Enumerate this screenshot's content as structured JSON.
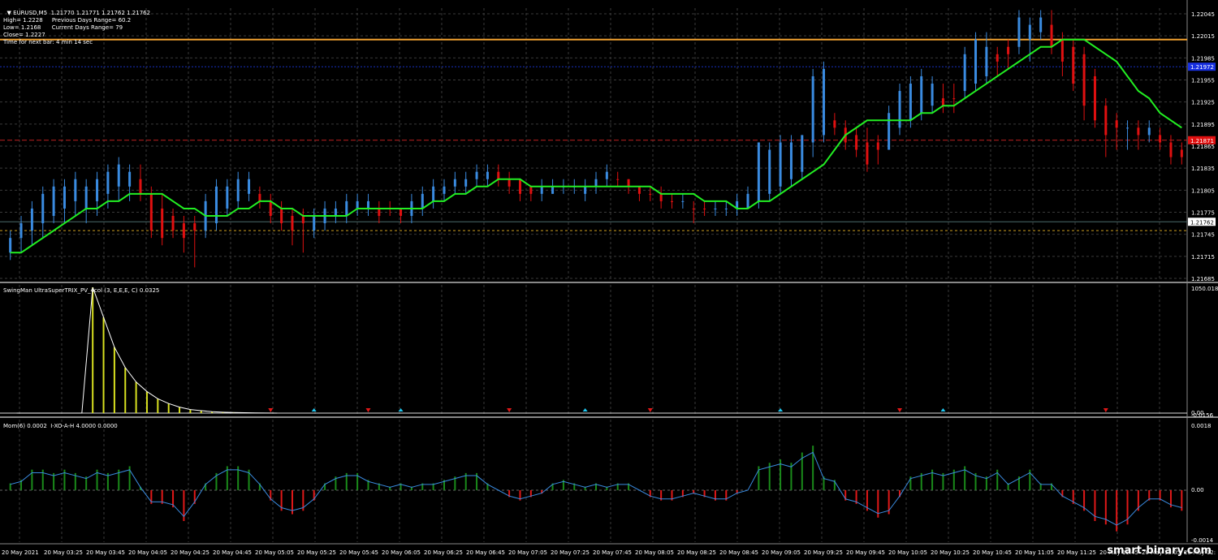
{
  "colors": {
    "background": "#000000",
    "grid": "#3a3a3a",
    "bull": "#3a8be0",
    "bear": "#e01010",
    "ma": "#22ee22",
    "orange_line": "#f0a030",
    "blue_line": "#1830c0",
    "red_dash": "#c02020",
    "bid_line": "#4a6a6a",
    "yellow_dash": "#d0a020",
    "trix": "#ffffff",
    "trix_bar": "#d8e020",
    "arrow_up": "#20c8f0",
    "arrow_down": "#e01818",
    "mom_pos": "#1a8a1a",
    "mom_neg": "#e01818",
    "mom_line": "#3a8be0"
  },
  "main": {
    "symbol": "EURUSD,M5",
    "ohlc": "1.21770 1.21771 1.21762 1.21762",
    "high": "High= 1.2228",
    "prev_range": "Previous Days Range= 60.2",
    "low": "Low= 1.2168",
    "curr_range": "Current Days Range= 79",
    "close": "Close= 1.2227",
    "timer": "Time for next bar: 4 min 14 sec",
    "price_axis": [
      "1.22045",
      "1.22015",
      "1.21985",
      "1.21955",
      "1.21925",
      "1.21895",
      "1.21865",
      "1.21835",
      "1.21805",
      "1.21775",
      "1.21745",
      "1.21715",
      "1.21685"
    ],
    "levels": {
      "orange": 1.2201,
      "blue": 1.21973,
      "red": 1.21873,
      "bid": 1.21762,
      "yellow": 1.2175
    },
    "level_labels": {
      "blue": "1.21972",
      "red": "1.21871",
      "bid": "1.21762"
    }
  },
  "trix": {
    "label": "SwingMan UltraSuperTRIX_PV_4col (3, E,E,E, C) 0.0325",
    "axis_top": "1050.0187",
    "axis_mid": "0.00",
    "axis_bottom": "-0.0156"
  },
  "mom": {
    "label": "Mom(6) 0.0002  I-XO-A-H 4.0000 0.0000",
    "axis_top": "0.0018",
    "axis_mid": "0.00",
    "axis_bottom": "-0.0014"
  },
  "time_axis": [
    "20 May 2021",
    "20 May 03:25",
    "20 May 03:45",
    "20 May 04:05",
    "20 May 04:25",
    "20 May 04:45",
    "20 May 05:05",
    "20 May 05:25",
    "20 May 05:45",
    "20 May 06:05",
    "20 May 06:25",
    "20 May 06:45",
    "20 May 07:05",
    "20 May 07:25",
    "20 May 07:45",
    "20 May 08:05",
    "20 May 08:25",
    "20 May 08:45",
    "20 May 09:05",
    "20 May 09:25",
    "20 May 09:45",
    "20 May 10:05",
    "20 May 10:25",
    "20 May 10:45",
    "20 May 11:05",
    "20 May 11:25",
    "20 May 11:45",
    "20 May 12:05",
    "20 May 12:"
  ],
  "watermark": "smart-binary.com",
  "chart_data": {
    "type": "bar",
    "title": "EURUSD,M5",
    "ylim": [
      1.2168,
      1.2207
    ],
    "candles": [
      [
        0,
        1.2172,
        1.2175,
        1.2171,
        1.2174,
        1
      ],
      [
        1,
        1.2174,
        1.2177,
        1.2172,
        1.2176,
        1
      ],
      [
        2,
        1.2175,
        1.2179,
        1.2173,
        1.2178,
        1
      ],
      [
        3,
        1.2176,
        1.2181,
        1.2174,
        1.218,
        1
      ],
      [
        4,
        1.2177,
        1.2182,
        1.2176,
        1.2181,
        1
      ],
      [
        5,
        1.2178,
        1.2182,
        1.2176,
        1.2181,
        1
      ],
      [
        6,
        1.2179,
        1.2183,
        1.2177,
        1.2182,
        1
      ],
      [
        7,
        1.2178,
        1.2182,
        1.2176,
        1.2181,
        1
      ],
      [
        8,
        1.2179,
        1.2183,
        1.2177,
        1.2182,
        1
      ],
      [
        9,
        1.218,
        1.2184,
        1.2178,
        1.2183,
        1
      ],
      [
        10,
        1.2181,
        1.2185,
        1.2179,
        1.2184,
        1
      ],
      [
        11,
        1.2181,
        1.2184,
        1.2179,
        1.2183,
        1
      ],
      [
        12,
        1.2182,
        1.2184,
        1.2179,
        1.218,
        0
      ],
      [
        13,
        1.218,
        1.2181,
        1.2174,
        1.2175,
        0
      ],
      [
        14,
        1.2178,
        1.218,
        1.2173,
        1.2174,
        0
      ],
      [
        15,
        1.2177,
        1.2178,
        1.2174,
        1.2175,
        0
      ],
      [
        16,
        1.2176,
        1.2177,
        1.2172,
        1.2174,
        0
      ],
      [
        17,
        1.2176,
        1.2177,
        1.217,
        1.2175,
        0
      ],
      [
        18,
        1.2175,
        1.218,
        1.2174,
        1.2179,
        1
      ],
      [
        19,
        1.2176,
        1.2182,
        1.2175,
        1.2181,
        1
      ],
      [
        20,
        1.2178,
        1.2182,
        1.2177,
        1.2181,
        1
      ],
      [
        21,
        1.2179,
        1.2183,
        1.2178,
        1.2182,
        1
      ],
      [
        22,
        1.218,
        1.2183,
        1.2179,
        1.2182,
        1
      ],
      [
        23,
        1.218,
        1.2181,
        1.2178,
        1.2179,
        0
      ],
      [
        24,
        1.2179,
        1.218,
        1.2176,
        1.2177,
        0
      ],
      [
        25,
        1.2178,
        1.2179,
        1.2175,
        1.2176,
        0
      ],
      [
        26,
        1.2177,
        1.2178,
        1.2173,
        1.2175,
        0
      ],
      [
        27,
        1.2176,
        1.2178,
        1.2172,
        1.2177,
        0
      ],
      [
        28,
        1.2175,
        1.2178,
        1.2174,
        1.2177,
        1
      ],
      [
        29,
        1.2176,
        1.2179,
        1.2175,
        1.2178,
        1
      ],
      [
        30,
        1.2177,
        1.2179,
        1.2176,
        1.2178,
        1
      ],
      [
        31,
        1.2177,
        1.218,
        1.2176,
        1.2179,
        1
      ],
      [
        32,
        1.2178,
        1.218,
        1.2177,
        1.2179,
        1
      ],
      [
        33,
        1.2178,
        1.218,
        1.2177,
        1.2179,
        1
      ],
      [
        34,
        1.2178,
        1.2179,
        1.2176,
        1.2177,
        0
      ],
      [
        35,
        1.2178,
        1.2179,
        1.2177,
        1.2178,
        0
      ],
      [
        36,
        1.2178,
        1.2178,
        1.2176,
        1.2177,
        0
      ],
      [
        37,
        1.2177,
        1.218,
        1.2176,
        1.2179,
        1
      ],
      [
        38,
        1.2178,
        1.2181,
        1.2177,
        1.218,
        1
      ],
      [
        39,
        1.2179,
        1.2182,
        1.2178,
        1.2181,
        1
      ],
      [
        40,
        1.218,
        1.2182,
        1.2179,
        1.2181,
        1
      ],
      [
        41,
        1.2181,
        1.2183,
        1.218,
        1.2182,
        1
      ],
      [
        42,
        1.2181,
        1.2183,
        1.218,
        1.2182,
        1
      ],
      [
        43,
        1.2182,
        1.2184,
        1.2181,
        1.2183,
        1
      ],
      [
        44,
        1.2182,
        1.2184,
        1.2181,
        1.2183,
        1
      ],
      [
        45,
        1.2183,
        1.2184,
        1.2181,
        1.2182,
        0
      ],
      [
        46,
        1.2182,
        1.2183,
        1.218,
        1.2181,
        0
      ],
      [
        47,
        1.2182,
        1.2182,
        1.2179,
        1.218,
        0
      ],
      [
        48,
        1.2181,
        1.2181,
        1.2179,
        1.218,
        0
      ],
      [
        49,
        1.218,
        1.2182,
        1.2179,
        1.2181,
        1
      ],
      [
        50,
        1.218,
        1.2182,
        1.218,
        1.2181,
        1
      ],
      [
        51,
        1.2181,
        1.2182,
        1.218,
        1.2181,
        1
      ],
      [
        52,
        1.2181,
        1.2182,
        1.218,
        1.2181,
        1
      ],
      [
        53,
        1.218,
        1.2182,
        1.2179,
        1.2181,
        1
      ],
      [
        54,
        1.2181,
        1.2183,
        1.218,
        1.2182,
        1
      ],
      [
        55,
        1.2182,
        1.2184,
        1.2181,
        1.2183,
        1
      ],
      [
        56,
        1.2182,
        1.2183,
        1.2181,
        1.2182,
        0
      ],
      [
        57,
        1.2182,
        1.2182,
        1.218,
        1.2181,
        0
      ],
      [
        58,
        1.2181,
        1.2181,
        1.2179,
        1.218,
        0
      ],
      [
        59,
        1.218,
        1.2181,
        1.2179,
        1.218,
        0
      ],
      [
        60,
        1.218,
        1.2181,
        1.2178,
        1.2179,
        0
      ],
      [
        61,
        1.2179,
        1.218,
        1.2178,
        1.2179,
        0
      ],
      [
        62,
        1.2179,
        1.218,
        1.2178,
        1.2179,
        1
      ],
      [
        63,
        1.2178,
        1.2179,
        1.2176,
        1.2178,
        0
      ],
      [
        64,
        1.2178,
        1.2179,
        1.2177,
        1.2178,
        0
      ],
      [
        65,
        1.2178,
        1.2179,
        1.2177,
        1.2178,
        1
      ],
      [
        66,
        1.2178,
        1.2179,
        1.2177,
        1.2178,
        1
      ],
      [
        67,
        1.2178,
        1.218,
        1.2177,
        1.2179,
        1
      ],
      [
        68,
        1.2178,
        1.2181,
        1.2178,
        1.218,
        1
      ],
      [
        69,
        1.2179,
        1.2187,
        1.2178,
        1.2187,
        1
      ],
      [
        70,
        1.218,
        1.2187,
        1.2179,
        1.2186,
        1
      ],
      [
        71,
        1.2181,
        1.2188,
        1.218,
        1.2187,
        1
      ],
      [
        72,
        1.2182,
        1.2188,
        1.2181,
        1.2187,
        1
      ],
      [
        73,
        1.2183,
        1.2188,
        1.2182,
        1.2188,
        1
      ],
      [
        74,
        1.2187,
        1.2197,
        1.2185,
        1.2196,
        1
      ],
      [
        75,
        1.2188,
        1.2198,
        1.2187,
        1.2197,
        1
      ],
      [
        76,
        1.219,
        1.2191,
        1.2188,
        1.2189,
        0
      ],
      [
        77,
        1.2189,
        1.219,
        1.2186,
        1.2187,
        0
      ],
      [
        78,
        1.2188,
        1.2189,
        1.2185,
        1.2186,
        0
      ],
      [
        79,
        1.2187,
        1.2189,
        1.2183,
        1.2184,
        0
      ],
      [
        80,
        1.2186,
        1.2188,
        1.2184,
        1.2187,
        0
      ],
      [
        81,
        1.2186,
        1.2192,
        1.2186,
        1.2191,
        1
      ],
      [
        82,
        1.2189,
        1.2195,
        1.2188,
        1.2194,
        1
      ],
      [
        83,
        1.219,
        1.2196,
        1.2189,
        1.2195,
        1
      ],
      [
        84,
        1.2191,
        1.2197,
        1.219,
        1.2196,
        1
      ],
      [
        85,
        1.2192,
        1.2196,
        1.2191,
        1.2195,
        1
      ],
      [
        86,
        1.2193,
        1.2195,
        1.2191,
        1.2192,
        0
      ],
      [
        87,
        1.2193,
        1.2195,
        1.2191,
        1.2193,
        0
      ],
      [
        88,
        1.2194,
        1.22,
        1.2193,
        1.2199,
        1
      ],
      [
        89,
        1.2195,
        1.2202,
        1.2194,
        1.2201,
        1
      ],
      [
        90,
        1.2196,
        1.2202,
        1.2195,
        1.22,
        1
      ],
      [
        91,
        1.2198,
        1.22,
        1.2196,
        1.2199,
        0
      ],
      [
        92,
        1.2199,
        1.2201,
        1.2197,
        1.22,
        0
      ],
      [
        93,
        1.22,
        1.2205,
        1.2199,
        1.2204,
        1
      ],
      [
        94,
        1.2201,
        1.2204,
        1.2198,
        1.2203,
        1
      ],
      [
        95,
        1.2202,
        1.2205,
        1.2201,
        1.2204,
        1
      ],
      [
        96,
        1.2203,
        1.2205,
        1.2199,
        1.22,
        0
      ],
      [
        97,
        1.2201,
        1.2202,
        1.2196,
        1.2198,
        0
      ],
      [
        98,
        1.22,
        1.2201,
        1.2194,
        1.2195,
        0
      ],
      [
        99,
        1.2199,
        1.22,
        1.219,
        1.2192,
        0
      ],
      [
        100,
        1.2196,
        1.2197,
        1.2189,
        1.219,
        0
      ],
      [
        101,
        1.2192,
        1.2193,
        1.2185,
        1.2188,
        0
      ],
      [
        102,
        1.219,
        1.2191,
        1.2186,
        1.2189,
        0
      ],
      [
        103,
        1.2189,
        1.219,
        1.2186,
        1.2189,
        1
      ],
      [
        104,
        1.2189,
        1.219,
        1.2186,
        1.2188,
        0
      ],
      [
        105,
        1.2188,
        1.219,
        1.2187,
        1.2189,
        1
      ],
      [
        106,
        1.2188,
        1.2189,
        1.2186,
        1.2187,
        0
      ],
      [
        107,
        1.2187,
        1.2188,
        1.2184,
        1.2185,
        0
      ],
      [
        108,
        1.2186,
        1.2187,
        1.2184,
        1.2185,
        0
      ]
    ],
    "ma": [
      1.2172,
      1.2172,
      1.2173,
      1.2174,
      1.2175,
      1.2176,
      1.2177,
      1.2178,
      1.2178,
      1.2179,
      1.2179,
      1.218,
      1.218,
      1.218,
      1.218,
      1.2179,
      1.2178,
      1.2178,
      1.2177,
      1.2177,
      1.2177,
      1.2178,
      1.2178,
      1.2179,
      1.2179,
      1.2178,
      1.2178,
      1.2177,
      1.2177,
      1.2177,
      1.2177,
      1.2177,
      1.2178,
      1.2178,
      1.2178,
      1.2178,
      1.2178,
      1.2178,
      1.2178,
      1.2179,
      1.2179,
      1.218,
      1.218,
      1.2181,
      1.2181,
      1.2182,
      1.2182,
      1.2182,
      1.2181,
      1.2181,
      1.2181,
      1.2181,
      1.2181,
      1.2181,
      1.2181,
      1.2181,
      1.2181,
      1.2181,
      1.2181,
      1.2181,
      1.218,
      1.218,
      1.218,
      1.218,
      1.2179,
      1.2179,
      1.2179,
      1.2178,
      1.2178,
      1.2179,
      1.2179,
      1.218,
      1.2181,
      1.2182,
      1.2183,
      1.2184,
      1.2186,
      1.2188,
      1.2189,
      1.219,
      1.219,
      1.219,
      1.219,
      1.219,
      1.2191,
      1.2191,
      1.2192,
      1.2192,
      1.2193,
      1.2194,
      1.2195,
      1.2196,
      1.2197,
      1.2198,
      1.2199,
      1.22,
      1.22,
      1.2201,
      1.2201,
      1.2201,
      1.22,
      1.2199,
      1.2198,
      1.2196,
      1.2194,
      1.2193,
      1.2191,
      1.219,
      1.2189
    ],
    "trix_spike": [
      0,
      0,
      0,
      0,
      0,
      0,
      0,
      1050,
      800,
      550,
      380,
      260,
      180,
      120,
      80,
      50,
      30,
      20,
      12,
      8,
      5,
      3,
      2,
      1,
      0
    ],
    "arrows": [
      {
        "i": 24,
        "dir": "down"
      },
      {
        "i": 28,
        "dir": "up"
      },
      {
        "i": 33,
        "dir": "down"
      },
      {
        "i": 36,
        "dir": "up"
      },
      {
        "i": 46,
        "dir": "down"
      },
      {
        "i": 53,
        "dir": "up"
      },
      {
        "i": 59,
        "dir": "down"
      },
      {
        "i": 71,
        "dir": "up"
      },
      {
        "i": 82,
        "dir": "down"
      },
      {
        "i": 86,
        "dir": "up"
      },
      {
        "i": 101,
        "dir": "down"
      }
    ],
    "momentum": [
      0.0002,
      0.0003,
      0.0006,
      0.0006,
      0.0005,
      0.0006,
      0.0005,
      0.0004,
      0.0006,
      0.0005,
      0.0006,
      0.0007,
      0.0001,
      -0.0004,
      -0.0004,
      -0.0005,
      -0.0009,
      -0.0004,
      0.0002,
      0.0005,
      0.0007,
      0.0007,
      0.0006,
      0.0002,
      -0.0003,
      -0.0006,
      -0.0007,
      -0.0006,
      -0.0003,
      0.0002,
      0.0004,
      0.0005,
      0.0005,
      0.0003,
      0.0002,
      0.0001,
      0.0002,
      0.0001,
      0.0002,
      0.0002,
      0.0003,
      0.0004,
      0.0005,
      0.0005,
      0.0002,
      0.0,
      -0.0002,
      -0.0003,
      -0.0002,
      -0.0001,
      0.0002,
      0.0003,
      0.0002,
      0.0001,
      0.0002,
      0.0001,
      0.0002,
      0.0002,
      0.0,
      -0.0002,
      -0.0003,
      -0.0003,
      -0.0002,
      -0.0001,
      -0.0002,
      -0.0003,
      -0.0003,
      -0.0001,
      0.0,
      0.0007,
      0.0008,
      0.0009,
      0.0008,
      0.0011,
      0.0013,
      0.0004,
      0.0003,
      -0.0003,
      -0.0004,
      -0.0006,
      -0.0008,
      -0.0007,
      -0.0002,
      0.0004,
      0.0005,
      0.0006,
      0.0005,
      0.0006,
      0.0007,
      0.0005,
      0.0004,
      0.0006,
      0.0002,
      0.0004,
      0.0006,
      0.0002,
      0.0002,
      -0.0002,
      -0.0004,
      -0.0006,
      -0.0009,
      -0.001,
      -0.0012,
      -0.001,
      -0.0006,
      -0.0003,
      -0.0003,
      -0.0005,
      -0.0006
    ]
  }
}
